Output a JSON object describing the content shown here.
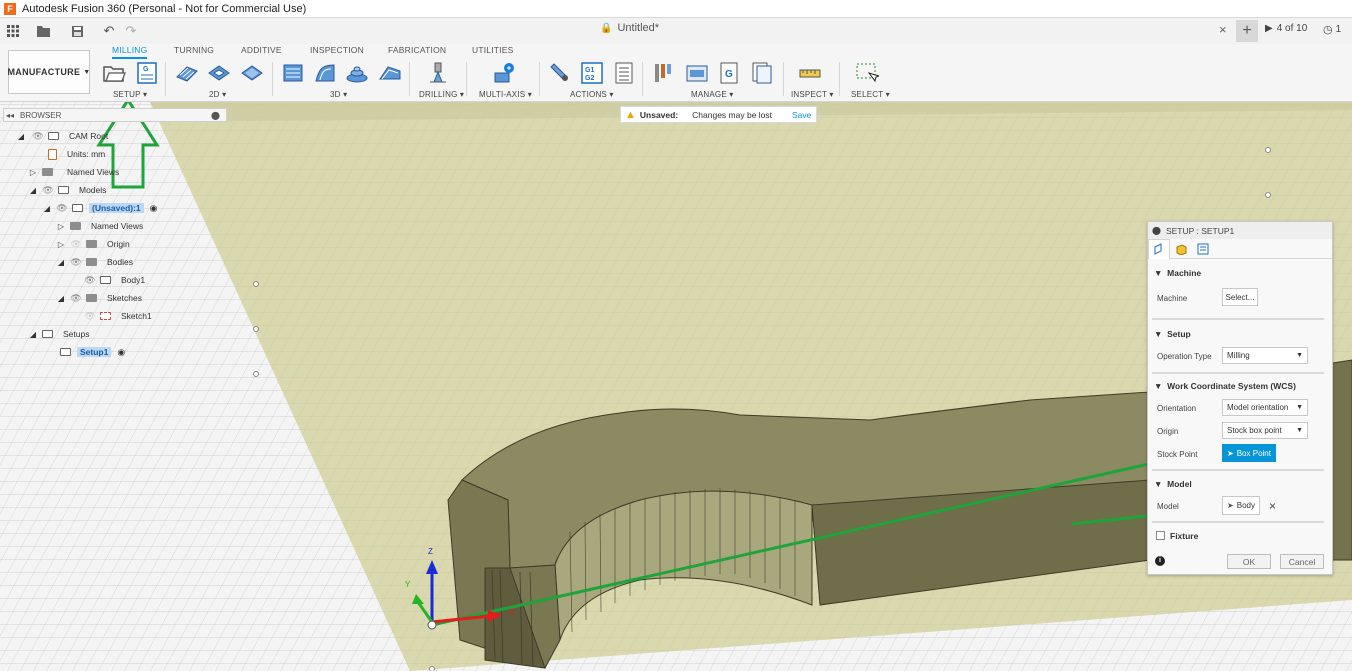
{
  "window": {
    "title": "Autodesk Fusion 360 (Personal - Not for Commercial Use)"
  },
  "tabbar": {
    "document_title": "Untitled*",
    "close_glyph": "×",
    "add_glyph": "+",
    "jobs_label": "4 of 10",
    "notifications_count": "1"
  },
  "ribbon": {
    "workspace": "MANUFACTURE",
    "tabs": [
      "MILLING",
      "TURNING",
      "ADDITIVE",
      "INSPECTION",
      "FABRICATION",
      "UTILITIES"
    ],
    "active_tab": "MILLING",
    "groups": [
      "SETUP",
      "2D",
      "3D",
      "DRILLING",
      "MULTI-AXIS",
      "ACTIONS",
      "MANAGE",
      "INSPECT",
      "SELECT"
    ]
  },
  "browser": {
    "title": "BROWSER",
    "items": [
      {
        "label": "CAM Root"
      },
      {
        "label": "Units: mm"
      },
      {
        "label": "Named Views"
      },
      {
        "label": "Models"
      },
      {
        "label": "(Unsaved):1"
      },
      {
        "label": "Named Views"
      },
      {
        "label": "Origin"
      },
      {
        "label": "Bodies"
      },
      {
        "label": "Body1"
      },
      {
        "label": "Sketches"
      },
      {
        "label": "Sketch1"
      },
      {
        "label": "Setups"
      },
      {
        "label": "Setup1"
      }
    ]
  },
  "unsaved_bar": {
    "title": "Unsaved:",
    "message": "Changes may be lost",
    "save_label": "Save"
  },
  "setup_panel": {
    "title": "SETUP : SETUP1",
    "machine": {
      "section": "Machine",
      "machine_label": "Machine",
      "select_button": "Select..."
    },
    "setup": {
      "section": "Setup",
      "operation_type_label": "Operation Type",
      "operation_type_value": "Milling"
    },
    "wcs": {
      "section": "Work Coordinate System (WCS)",
      "orientation_label": "Orientation",
      "orientation_value": "Model orientation",
      "origin_label": "Origin",
      "origin_value": "Stock box point",
      "stock_point_label": "Stock Point",
      "box_point_button": "Box Point"
    },
    "model": {
      "section": "Model",
      "model_label": "Model",
      "body_button": "Body",
      "clear_glyph": "×"
    },
    "fixture": {
      "label": "Fixture",
      "checked": false
    },
    "ok_label": "OK",
    "cancel_label": "Cancel"
  },
  "axis": {
    "z": "Z",
    "y": "Y",
    "x": "X"
  },
  "colors": {
    "accent": "#0696d7",
    "annotation_green": "#1fa33b",
    "model_fill": "#6f6d4a",
    "plane_fill": "#d8d7ad"
  }
}
